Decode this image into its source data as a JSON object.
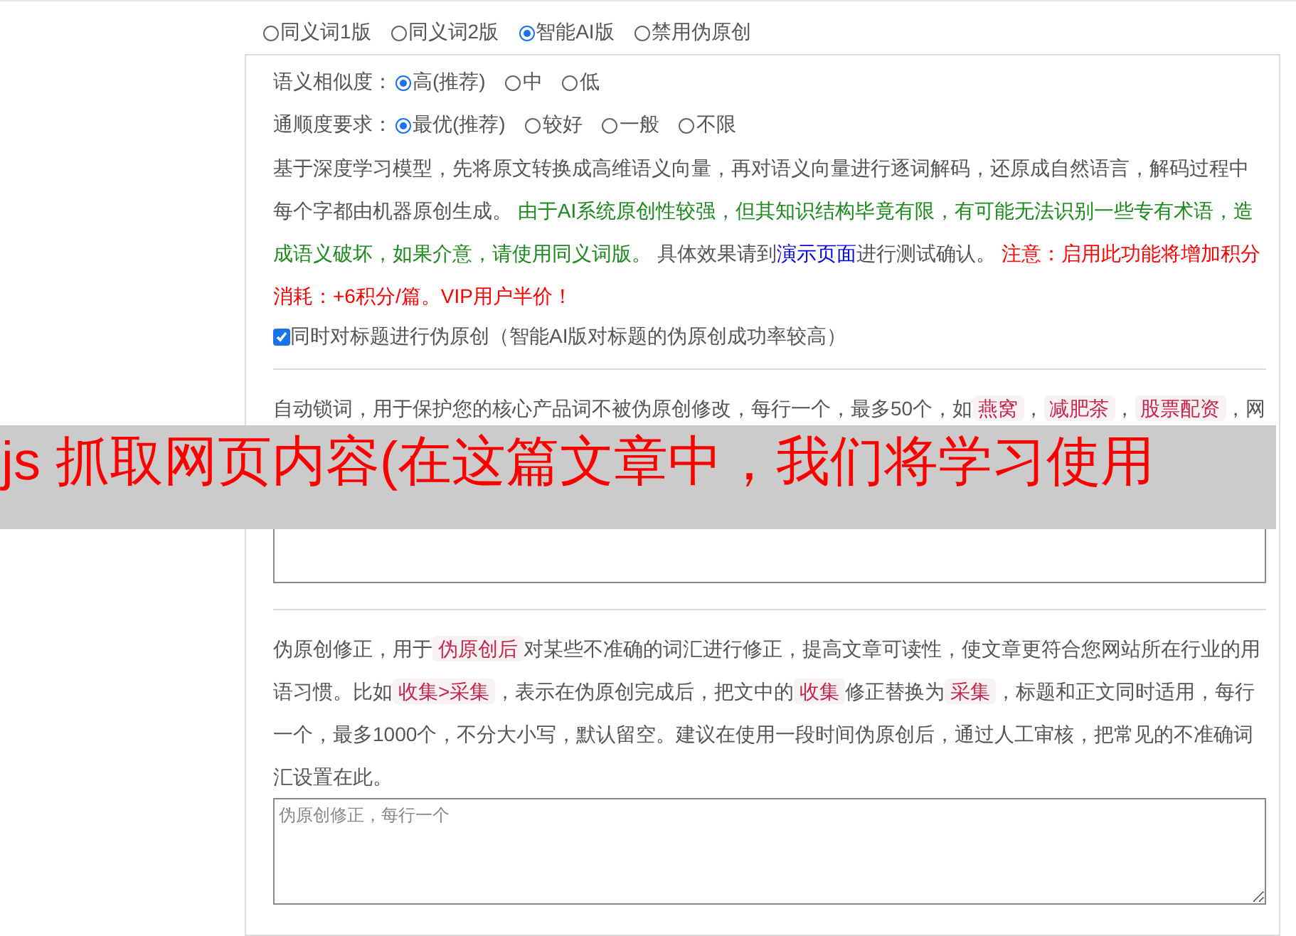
{
  "mode_options": [
    {
      "label": "同义词1版",
      "selected": false
    },
    {
      "label": "同义词2版",
      "selected": false
    },
    {
      "label": "智能AI版",
      "selected": true
    },
    {
      "label": "禁用伪原创",
      "selected": false
    }
  ],
  "settings": [
    {
      "label": "语义相似度：",
      "options": [
        {
          "label": "高(推荐)",
          "selected": true
        },
        {
          "label": "中",
          "selected": false
        },
        {
          "label": "低",
          "selected": false
        }
      ]
    },
    {
      "label": "通顺度要求：",
      "options": [
        {
          "label": "最优(推荐)",
          "selected": true
        },
        {
          "label": "较好",
          "selected": false
        },
        {
          "label": "一般",
          "selected": false
        },
        {
          "label": "不限",
          "selected": false
        }
      ]
    }
  ],
  "description": [
    {
      "kind": "plain",
      "text": "基于深度学习模型，先将原文转换成高维语义向量，再对语义向量进行逐词解码，还原成自然语言，解码过程中每个字都由机器原创生成。 "
    },
    {
      "kind": "green",
      "text": "由于AI系统原创性较强，但其知识结构毕竟有限，有可能无法识别一些专有术语，造成语义破坏，如果介意，请使用同义词版。"
    },
    {
      "kind": "plain",
      "text": " 具体效果请到"
    },
    {
      "kind": "link",
      "text": "演示页面"
    },
    {
      "kind": "plain",
      "text": "进行测试确认。 "
    },
    {
      "kind": "red",
      "text": "注意：启用此功能将增加积分消耗：+6积分/篇。VIP用户半价！"
    }
  ],
  "title_option": {
    "label": "同时对标题进行伪原创（智能AI版对标题的伪原创成功率较高）",
    "checked": true
  },
  "lock_words": {
    "text": [
      {
        "kind": "plain",
        "text": "自动锁词，用于保护您的核心产品词不被伪原创修改，每行一个，最多50个，如"
      },
      {
        "kind": "code",
        "text": "燕窝"
      },
      {
        "kind": "plain",
        "text": "，"
      },
      {
        "kind": "code",
        "text": "减肥茶"
      },
      {
        "kind": "plain",
        "text": "，"
      },
      {
        "kind": "code",
        "text": "股票配资"
      },
      {
        "kind": "plain",
        "text": "，网"
      }
    ]
  },
  "correction": {
    "text": [
      {
        "kind": "plain",
        "text": "伪原创修正，用于"
      },
      {
        "kind": "code",
        "text": "伪原创后"
      },
      {
        "kind": "plain",
        "text": "对某些不准确的词汇进行修正，提高文章可读性，使文章更符合您网站所在行业的用语习惯。比如"
      },
      {
        "kind": "code",
        "text": "收集>采集"
      },
      {
        "kind": "plain",
        "text": "，表示在伪原创完成后，把文中的"
      },
      {
        "kind": "code",
        "text": "收集"
      },
      {
        "kind": "plain",
        "text": "修正替换为"
      },
      {
        "kind": "code",
        "text": "采集"
      },
      {
        "kind": "plain",
        "text": "，标题和正文同时适用，每行一个，最多1000个，不分大小写，默认留空。建议在使用一段时间伪原创后，通过人工审核，把常见的不准确词汇设置在此。"
      }
    ],
    "placeholder": "伪原创修正，每行一个"
  },
  "banner": {
    "text": "js 抓取网页内容(在这篇文章中，我们将学习使用"
  }
}
